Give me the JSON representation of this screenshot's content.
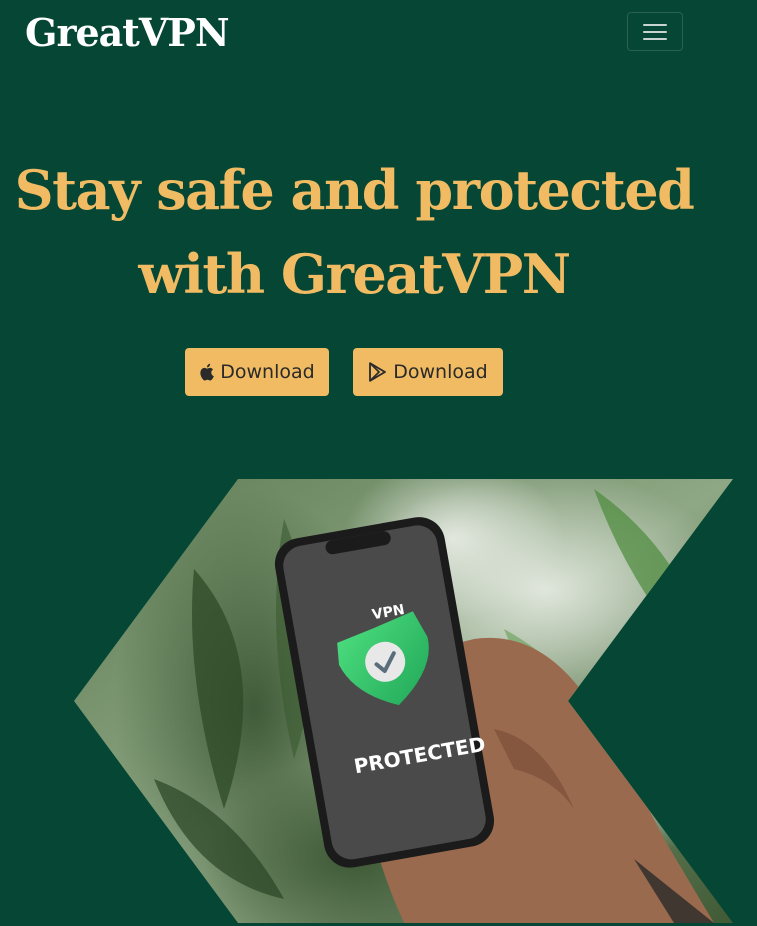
{
  "navbar": {
    "brand": "GreatVPN",
    "toggler_icon": "hamburger-menu-icon"
  },
  "hero": {
    "headline_line1": "Stay safe and protected",
    "headline_line2": "with GreatVPN",
    "buttons": [
      {
        "icon": "apple-icon",
        "label": "Download"
      },
      {
        "icon": "google-play-icon",
        "label": "Download"
      }
    ]
  },
  "phone_screen": {
    "top_label": "VPN",
    "status_label": "PROTECTED",
    "shield_icon": "shield-check-icon"
  },
  "colors": {
    "background": "#064635",
    "accent": "#f0bb62",
    "brand_text": "#ffffff",
    "shield": "#3ecf6e"
  }
}
